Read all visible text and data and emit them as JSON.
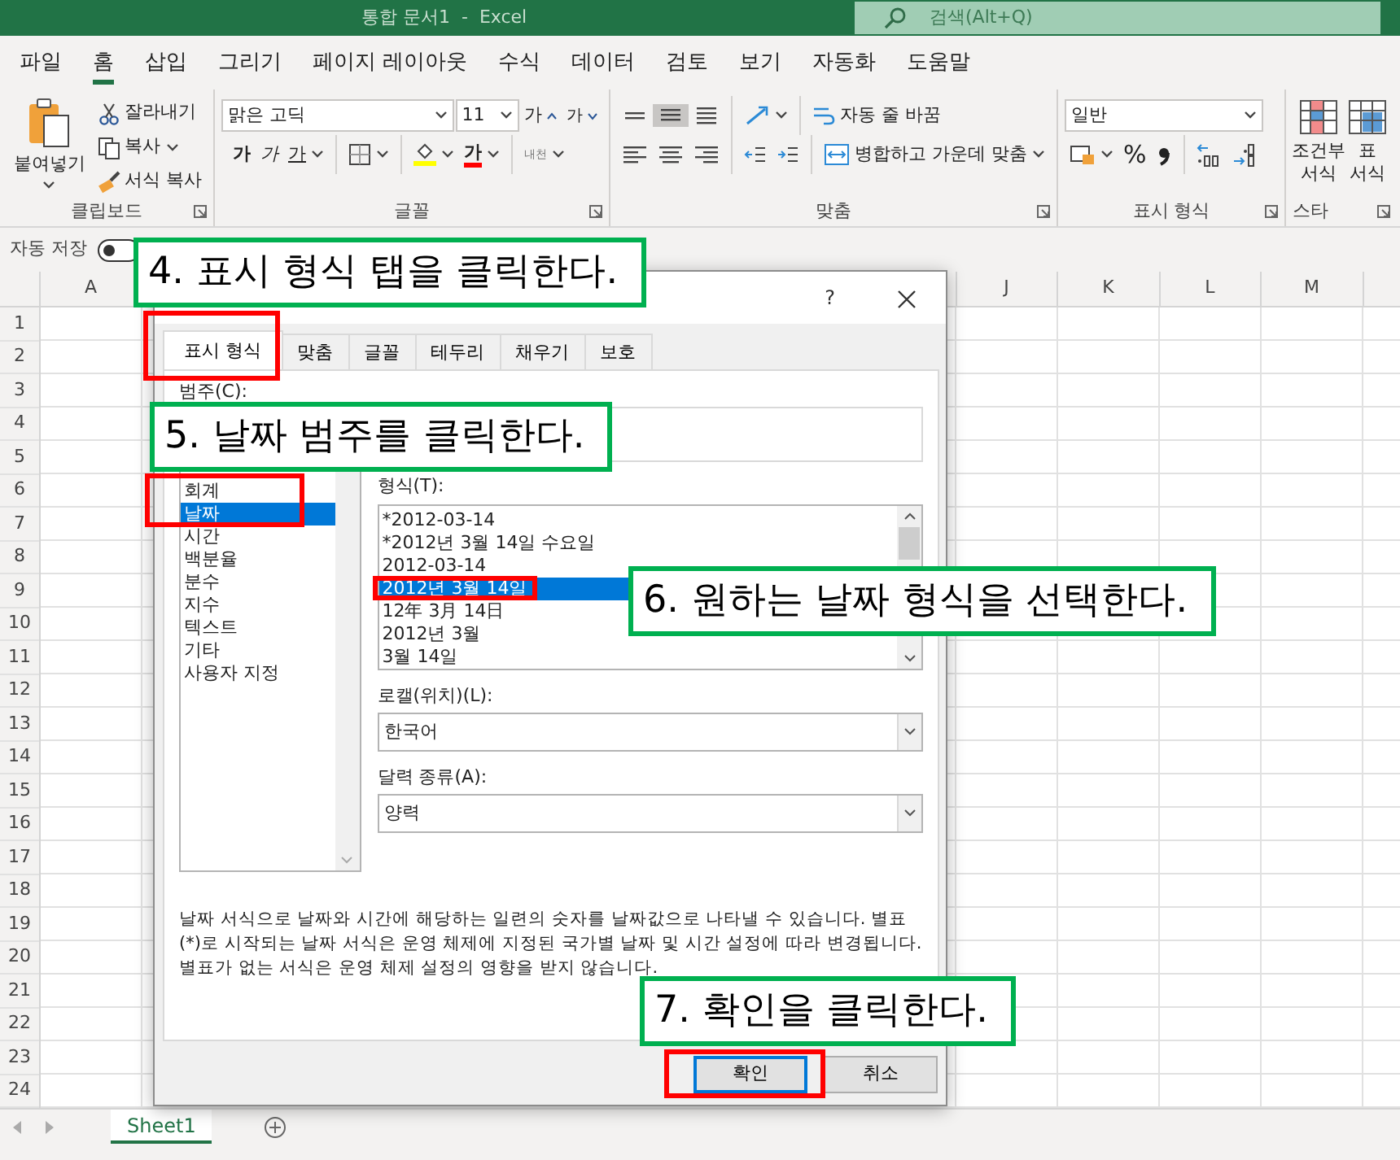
{
  "window": {
    "title": "통합 문서1  -  Excel",
    "search_placeholder": "검색(Alt+Q)"
  },
  "menu_tabs": [
    {
      "label": "파일",
      "selected": false
    },
    {
      "label": "홈",
      "selected": true
    },
    {
      "label": "삽입",
      "selected": false
    },
    {
      "label": "그리기",
      "selected": false
    },
    {
      "label": "페이지 레이아웃",
      "selected": false
    },
    {
      "label": "수식",
      "selected": false
    },
    {
      "label": "데이터",
      "selected": false
    },
    {
      "label": "검토",
      "selected": false
    },
    {
      "label": "보기",
      "selected": false
    },
    {
      "label": "자동화",
      "selected": false
    },
    {
      "label": "도움말",
      "selected": false
    }
  ],
  "ribbon": {
    "clipboard": {
      "paste": "붙여넣기",
      "cut": "잘라내기",
      "copy": "복사",
      "format_painter": "서식 복사",
      "label": "클립보드"
    },
    "font": {
      "name": "맑은 고딕",
      "size": "11",
      "grow": "가",
      "shrink": "가",
      "bold": "가",
      "italic": "가",
      "underline": "가",
      "font_color": "가",
      "phonetic": "내천",
      "label": "글꼴"
    },
    "alignment": {
      "wrap_text": "자동 줄 바꿈",
      "merge": "병합하고 가운데 맞춤",
      "label": "맞춤"
    },
    "number": {
      "format": "일반",
      "percent": "%",
      "label": "표시 형식"
    },
    "styles": {
      "conditional": "조건부 서식",
      "table": "표 서식",
      "label": "스타"
    }
  },
  "autosave": {
    "label": "자동 저장"
  },
  "sheet": {
    "column_headers": [
      "A",
      "J",
      "K",
      "L",
      "M"
    ],
    "row_headers": [
      "1",
      "2",
      "3",
      "4",
      "5",
      "6",
      "7",
      "8",
      "9",
      "10",
      "11",
      "12",
      "13",
      "14",
      "15",
      "16",
      "17",
      "18",
      "19",
      "20",
      "21",
      "22",
      "23",
      "24"
    ]
  },
  "sheet_tabs": [
    {
      "label": "Sheet1",
      "selected": true
    }
  ],
  "dialog": {
    "help": "?",
    "tabs": [
      {
        "label": "표시 형식",
        "selected": true,
        "highlighted": true
      },
      {
        "label": "맞춤",
        "selected": false,
        "highlighted": false
      },
      {
        "label": "글꼴",
        "selected": false,
        "highlighted": false
      },
      {
        "label": "테두리",
        "selected": false,
        "highlighted": false
      },
      {
        "label": "채우기",
        "selected": false,
        "highlighted": false
      },
      {
        "label": "보호",
        "selected": false,
        "highlighted": false
      }
    ],
    "category_label": "범주(C):",
    "categories": [
      {
        "label": "회계",
        "selected": false,
        "highlighted": false
      },
      {
        "label": "날짜",
        "selected": true,
        "highlighted": true
      },
      {
        "label": "시간",
        "selected": false,
        "highlighted": false
      },
      {
        "label": "백분율",
        "selected": false,
        "highlighted": false
      },
      {
        "label": "분수",
        "selected": false,
        "highlighted": false
      },
      {
        "label": "지수",
        "selected": false,
        "highlighted": false
      },
      {
        "label": "텍스트",
        "selected": false,
        "highlighted": false
      },
      {
        "label": "기타",
        "selected": false,
        "highlighted": false
      },
      {
        "label": "사용자 지정",
        "selected": false,
        "highlighted": false
      }
    ],
    "format_label": "형식(T):",
    "formats": [
      {
        "label": "*2012-03-14",
        "selected": false,
        "highlighted": false
      },
      {
        "label": "*2012년 3월 14일 수요일",
        "selected": false,
        "highlighted": false
      },
      {
        "label": "2012-03-14",
        "selected": false,
        "highlighted": false
      },
      {
        "label": "2012년 3월 14일",
        "selected": true,
        "highlighted": true
      },
      {
        "label": "12年 3月 14日",
        "selected": false,
        "highlighted": false
      },
      {
        "label": "2012년 3월",
        "selected": false,
        "highlighted": false
      },
      {
        "label": "3월 14일",
        "selected": false,
        "highlighted": false
      }
    ],
    "locale_label": "로캘(위치)(L):",
    "locale": "한국어",
    "calendar_label": "달력 종류(A):",
    "calendar": "양력",
    "description": "날짜 서식으로 날짜와 시간에 해당하는 일련의 숫자를 날짜값으로 나타낼 수 있습니다. 별표(*)로 시작되는 날짜 서식은 운영 체제에 지정된 국가별 날짜 및 시간 설정에 따라 변경됩니다. 별표가 없는 서식은 운영 체제 설정의 영향을 받지 않습니다.",
    "buttons": [
      {
        "label": "확인",
        "default": true,
        "highlighted": true
      },
      {
        "label": "취소",
        "default": false,
        "highlighted": false
      }
    ]
  },
  "callouts": [
    {
      "text": "4. 표시 형식 탭을 클릭한다."
    },
    {
      "text": "5. 날짜 범주를 클릭한다."
    },
    {
      "text": "6. 원하는 날짜 형식을 선택한다."
    },
    {
      "text": "7. 확인을 클릭한다."
    }
  ]
}
